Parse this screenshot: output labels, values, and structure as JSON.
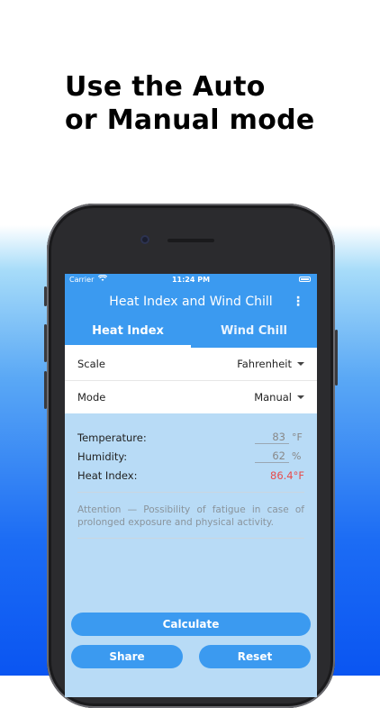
{
  "headline": {
    "line1": "Use the Auto",
    "line2": "or Manual mode"
  },
  "status_bar": {
    "carrier": "Carrier",
    "wifi_icon": "wifi-icon",
    "time": "11:24 PM",
    "battery_icon": "battery-icon"
  },
  "app_bar": {
    "title": "Heat Index and Wind Chill",
    "menu_icon": "⋮"
  },
  "tabs": [
    {
      "label": "Heat Index",
      "active": true
    },
    {
      "label": "Wind Chill",
      "active": false
    }
  ],
  "settings": {
    "scale": {
      "label": "Scale",
      "value": "Fahrenheit"
    },
    "mode": {
      "label": "Mode",
      "value": "Manual"
    }
  },
  "results": {
    "temperature": {
      "label": "Temperature:",
      "value": "83",
      "unit": "°F"
    },
    "humidity": {
      "label": "Humidity:",
      "value": "62",
      "unit": "%"
    },
    "heat_index": {
      "label": "Heat Index:",
      "value": "86.4°F"
    }
  },
  "attention": "Attention — Possibility of fatigue in case of prolonged exposure and physical activity.",
  "buttons": {
    "calculate": "Calculate",
    "share": "Share",
    "reset": "Reset"
  },
  "colors": {
    "accent": "#3b9af0",
    "warning": "#e74c4c",
    "panel": "#b8dbf6"
  }
}
